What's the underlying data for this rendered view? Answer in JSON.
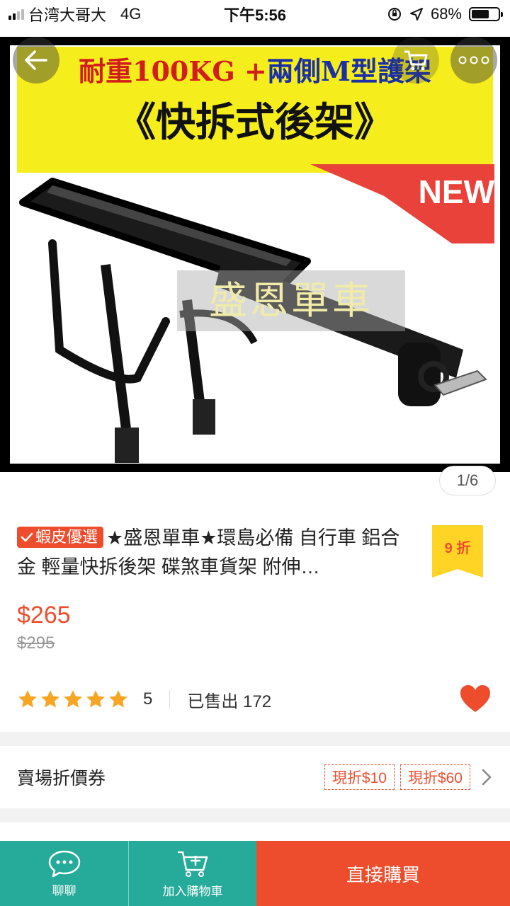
{
  "status_bar": {
    "carrier": "台湾大哥大",
    "network": "4G",
    "time": "下午5:56",
    "battery": "68%",
    "battery_level": 0.68
  },
  "hero": {
    "banner_line1_red": "耐重100KG +",
    "banner_line1_blue": "兩側M型護架",
    "banner_line2": "《快拆式後架》",
    "new_tag": "NEW",
    "watermark": "盛恩單車",
    "page_indicator": "1/6"
  },
  "product": {
    "preferred_badge": "蝦皮優選",
    "title": "★盛恩單車★環島必備 自行車 鋁合金 輕量快拆後架 碟煞車貨架 附伸…",
    "discount": "9 折",
    "price": "$265",
    "original_price": "$295",
    "rating": "5",
    "rating_stars": 5,
    "sold": "已售出 172"
  },
  "vouchers": {
    "label": "賣場折價券",
    "items": [
      "現折$10",
      "現折$60"
    ]
  },
  "bottom_bar": {
    "chat_label": "聊聊",
    "cart_label": "加入購物車",
    "buy_label": "直接購買"
  },
  "colors": {
    "brand": "#ee4d2d",
    "teal": "#26aa99",
    "star": "#f6a623"
  },
  "icons": [
    "back-arrow-icon",
    "cart-icon",
    "more-icon",
    "check-icon",
    "star-icon",
    "heart-icon",
    "chevron-right-icon",
    "chat-icon",
    "add-to-cart-icon",
    "location-arrow-icon",
    "rotation-lock-icon"
  ]
}
